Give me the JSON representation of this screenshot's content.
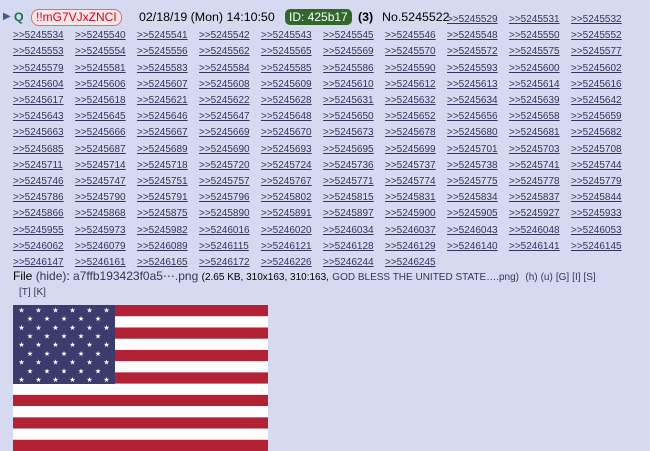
{
  "post": {
    "marker": "▶",
    "name": "Q",
    "tripcode": "!!mG7VJxZNCI",
    "datetime": "02/18/19 (Mon) 14:10:50",
    "id_badge": "ID: 425b17",
    "post_count": "(3)",
    "post_number": "No.5245522"
  },
  "replies": [
    ">>5245529",
    ">>5245531",
    ">>5245532",
    ">>5245534",
    ">>5245540",
    ">>5245541",
    ">>5245542",
    ">>5245543",
    ">>5245545",
    ">>5245546",
    ">>5245548",
    ">>5245550",
    ">>5245552",
    ">>5245553",
    ">>5245554",
    ">>5245556",
    ">>5245562",
    ">>5245565",
    ">>5245569",
    ">>5245570",
    ">>5245572",
    ">>5245575",
    ">>5245577",
    ">>5245579",
    ">>5245581",
    ">>5245583",
    ">>5245584",
    ">>5245585",
    ">>5245586",
    ">>5245590",
    ">>5245593",
    ">>5245600",
    ">>5245602",
    ">>5245604",
    ">>5245606",
    ">>5245607",
    ">>5245608",
    ">>5245609",
    ">>5245610",
    ">>5245612",
    ">>5245613",
    ">>5245614",
    ">>5245616",
    ">>5245617",
    ">>5245618",
    ">>5245621",
    ">>5245622",
    ">>5245628",
    ">>5245631",
    ">>5245632",
    ">>5245634",
    ">>5245639",
    ">>5245642",
    ">>5245643",
    ">>5245645",
    ">>5245646",
    ">>5245647",
    ">>5245648",
    ">>5245650",
    ">>5245652",
    ">>5245656",
    ">>5245658",
    ">>5245659",
    ">>5245663",
    ">>5245666",
    ">>5245667",
    ">>5245669",
    ">>5245670",
    ">>5245673",
    ">>5245678",
    ">>5245680",
    ">>5245681",
    ">>5245682",
    ">>5245685",
    ">>5245687",
    ">>5245689",
    ">>5245690",
    ">>5245693",
    ">>5245695",
    ">>5245699",
    ">>5245701",
    ">>5245703",
    ">>5245708",
    ">>5245711",
    ">>5245714",
    ">>5245718",
    ">>5245720",
    ">>5245724",
    ">>5245736",
    ">>5245737",
    ">>5245738",
    ">>5245741",
    ">>5245744",
    ">>5245746",
    ">>5245747",
    ">>5245751",
    ">>5245757",
    ">>5245767",
    ">>5245771",
    ">>5245774",
    ">>5245775",
    ">>5245778",
    ">>5245779",
    ">>5245786",
    ">>5245790",
    ">>5245791",
    ">>5245796",
    ">>5245802",
    ">>5245815",
    ">>5245831",
    ">>5245834",
    ">>5245837",
    ">>5245844",
    ">>5245866",
    ">>5245868",
    ">>5245875",
    ">>5245890",
    ">>5245891",
    ">>5245897",
    ">>5245900",
    ">>5245905",
    ">>5245927",
    ">>5245933",
    ">>5245955",
    ">>5245973",
    ">>5245982",
    ">>5246016",
    ">>5246020",
    ">>5246034",
    ">>5246037",
    ">>5246043",
    ">>5246048",
    ">>5246053",
    ">>5246062",
    ">>5246079",
    ">>5246089",
    ">>5246115",
    ">>5246121",
    ">>5246128",
    ">>5246129",
    ">>5246140",
    ">>5246141",
    ">>5246145",
    ">>5246147",
    ">>5246161",
    ">>5246165",
    ">>5246172",
    ">>5246226",
    ">>5246244",
    ">>5246245"
  ],
  "file": {
    "label": "File",
    "hide": "(hide)",
    "filename": "a7ffb193423f0a5⋯.png",
    "meta": "(2.65 KB, 310x163, 310:163,",
    "original_name": "GOD BLESS THE UNITED STATE….png)",
    "links": [
      "(h)",
      "(u)",
      "[G]",
      "[I]",
      "[S]",
      "[T]",
      "[K]"
    ]
  },
  "image": {
    "icon": "us-flag"
  },
  "colors": {
    "background": "#d6daf0",
    "link": "#34345c",
    "name": "#117743",
    "trip": "#e0001b",
    "id_bg": "#31672a",
    "flag_red": "#b22234",
    "flag_blue": "#3c3b6e"
  }
}
